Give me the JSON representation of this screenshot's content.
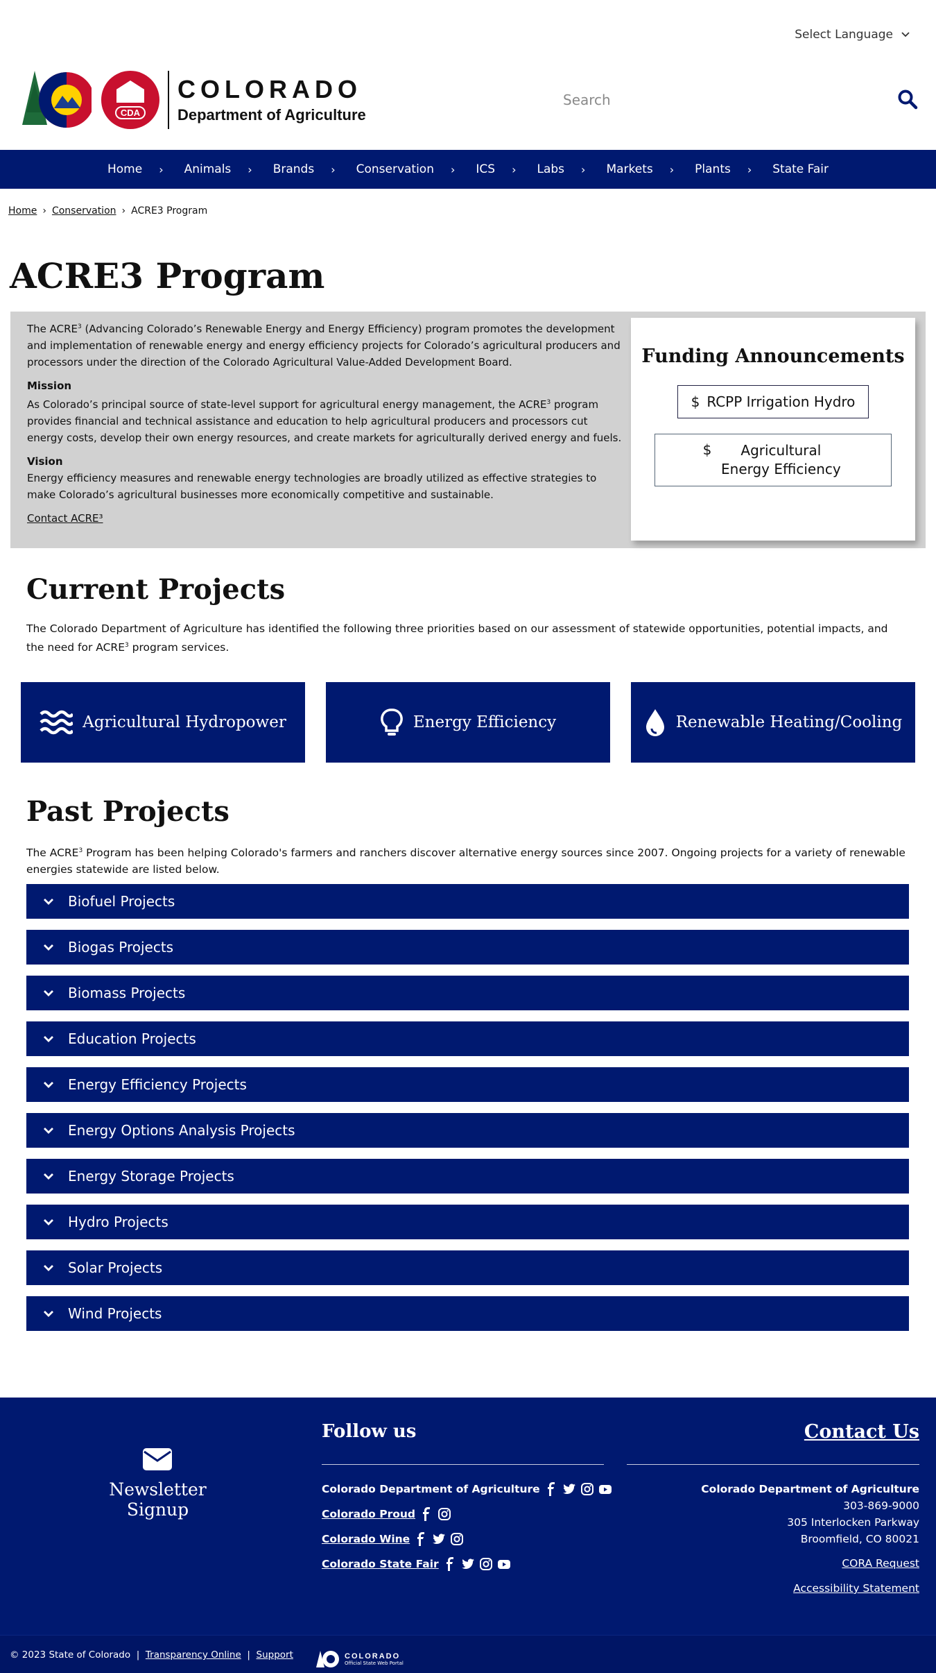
{
  "header": {
    "language_label": "Select Language",
    "brand_title": "COLORADO",
    "brand_subtitle": "Department of Agriculture",
    "seal_text": "CDA",
    "search_placeholder": "Search"
  },
  "nav": {
    "items": [
      "Home",
      "Animals",
      "Brands",
      "Conservation",
      "ICS",
      "Labs",
      "Markets",
      "Plants",
      "State Fair"
    ]
  },
  "breadcrumb": {
    "home": "Home",
    "section": "Conservation",
    "current": "ACRE3 Program",
    "separator": "›"
  },
  "page_title": "ACRE3 Program",
  "intro": {
    "p1_a": "The ACRE",
    "p1_sup": "3",
    "p1_b": " (Advancing Colorado’s Renewable Energy and Energy Efficiency) program promotes the development and implementation of renewable energy and energy efficiency projects for Colorado’s agricultural producers and processors under the direction of the Colorado Agricultural Value-Added Development Board.",
    "mission_heading": "Mission",
    "mission_a": "As Colorado’s principal source of state-level support for agricultural energy management, the ACRE",
    "mission_sup": "3",
    "mission_b": " program provides financial and technical assistance and education to help agricultural producers and processors cut energy costs, develop their own energy resources, and create markets for agriculturally derived energy and fuels.",
    "vision_heading": "Vision",
    "vision": "Energy efficiency measures and renewable energy technologies are broadly utilized as effective strategies to make Colorado’s agricultural businesses more economically competitive and sustainable.",
    "contact_link": "Contact ACRE³"
  },
  "funding": {
    "heading": "Funding Announcements",
    "buttons": [
      "RCPP Irrigation Hydro",
      "Agricultural Energy Efficiency"
    ],
    "icon_glyph": "$"
  },
  "current_projects": {
    "heading": "Current Projects",
    "text_a": "The Colorado Department of Agriculture has identified the following three priorities based on our assessment of statewide opportunities, potential impacts, and the need for ACRE",
    "text_sup": "3",
    "text_b": " program services.",
    "cards": [
      "Agricultural Hydropower",
      "Energy Efficiency",
      "Renewable Heating/Cooling"
    ]
  },
  "past_projects": {
    "heading": "Past Projects",
    "text_a": "The ACRE",
    "text_sup": "3",
    "text_b": " Program has been helping Colorado's farmers and ranchers discover alternative energy sources since 2007. Ongoing projects for a variety of renewable energies statewide are listed below.",
    "items": [
      "Biofuel Projects",
      "Biogas Projects",
      "Biomass Projects",
      "Education Projects",
      "Energy Efficiency Projects",
      "Energy Options Analysis Projects",
      "Energy Storage Projects",
      "Hydro Projects",
      "Solar Projects",
      "Wind Projects"
    ]
  },
  "footer": {
    "newsletter": "Newsletter Signup",
    "follow_heading": "Follow us",
    "contact_heading": "Contact Us",
    "social": [
      "Colorado Department of Agriculture",
      "Colorado Proud",
      "Colorado Wine",
      "Colorado State Fair"
    ],
    "org": "Colorado Department of Agriculture",
    "phone": "303-869-9000",
    "street": "305 Interlocken Parkway",
    "city": "Broomfield, CO 80021",
    "cora": "CORA Request",
    "accessibility": "Accessibility Statement",
    "copyright": "© 2023 State of Colorado",
    "transparency": "Transparency Online",
    "support": "Support",
    "portal_title": "COLORADO",
    "portal_sub": "Official State Web Portal",
    "bar_sep": "|"
  },
  "colors": {
    "navy": "#001970",
    "intro_bg": "#d1d1d1",
    "logo_red": "#c8102e",
    "logo_gold": "#ffd100",
    "logo_green": "#1e6b3a"
  }
}
